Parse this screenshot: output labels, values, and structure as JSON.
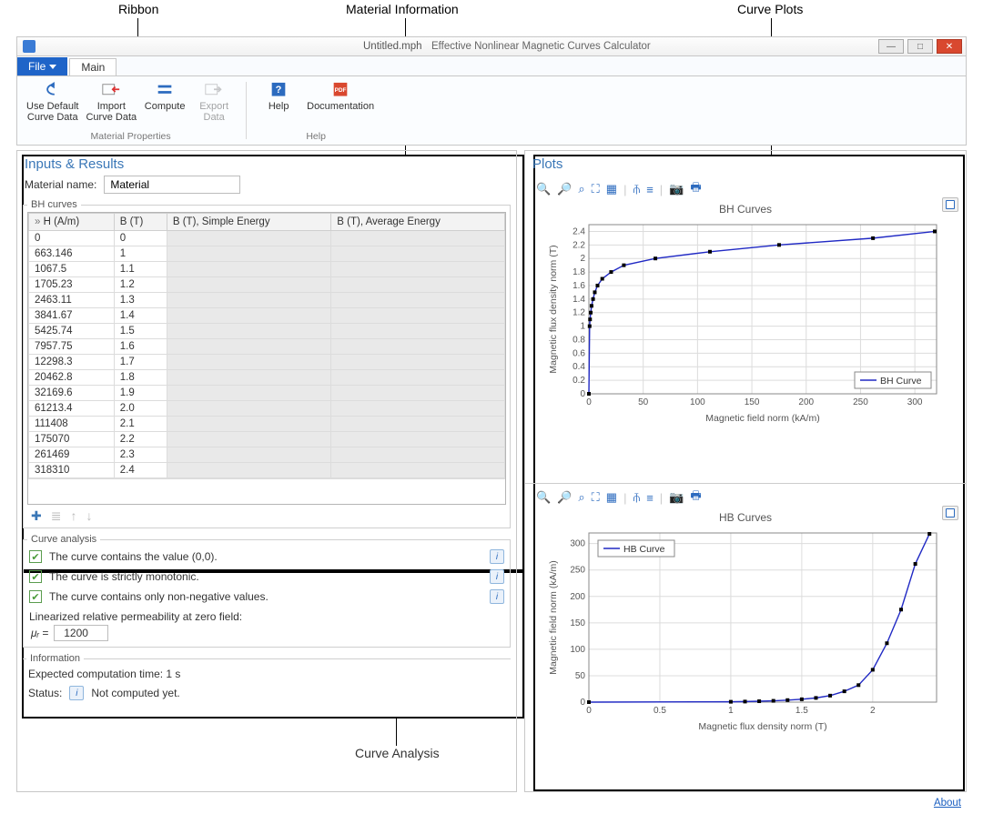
{
  "annotations": {
    "ribbon": "Ribbon",
    "material_info": "Material Information",
    "curve_plots": "Curve Plots",
    "curve_analysis": "Curve Analysis"
  },
  "window": {
    "file": "Untitled.mph",
    "app_title": "Effective Nonlinear Magnetic Curves Calculator",
    "min": "—",
    "max": "□",
    "close": "✕"
  },
  "tabs": {
    "file": "File",
    "main": "Main"
  },
  "ribbon": {
    "buttons": [
      {
        "label1": "Use Default",
        "label2": "Curve Data",
        "name": "use-default-button",
        "enabled": true
      },
      {
        "label1": "Import",
        "label2": "Curve Data",
        "name": "import-button",
        "enabled": true
      },
      {
        "label1": "Compute",
        "label2": "",
        "name": "compute-button",
        "enabled": true
      },
      {
        "label1": "Export",
        "label2": "Data",
        "name": "export-button",
        "enabled": false
      }
    ],
    "group1": "Material Properties",
    "help_buttons": [
      {
        "label": "Help",
        "name": "help-button"
      },
      {
        "label": "Documentation",
        "name": "documentation-button"
      }
    ],
    "group2": "Help"
  },
  "inputs": {
    "section_title": "Inputs & Results",
    "material_name_label": "Material name:",
    "material_name_value": "Material",
    "bh_group": "BH curves",
    "columns": [
      "H (A/m)",
      "B (T)",
      "B (T), Simple Energy",
      "B (T), Average Energy"
    ],
    "rows": [
      [
        "0",
        "0"
      ],
      [
        "663.146",
        "1"
      ],
      [
        "1067.5",
        "1.1"
      ],
      [
        "1705.23",
        "1.2"
      ],
      [
        "2463.11",
        "1.3"
      ],
      [
        "3841.67",
        "1.4"
      ],
      [
        "5425.74",
        "1.5"
      ],
      [
        "7957.75",
        "1.6"
      ],
      [
        "12298.3",
        "1.7"
      ],
      [
        "20462.8",
        "1.8"
      ],
      [
        "32169.6",
        "1.9"
      ],
      [
        "61213.4",
        "2.0"
      ],
      [
        "111408",
        "2.1"
      ],
      [
        "175070",
        "2.2"
      ],
      [
        "261469",
        "2.3"
      ],
      [
        "318310",
        "2.4"
      ]
    ]
  },
  "analysis": {
    "group": "Curve analysis",
    "checks": [
      "The curve contains the value (0,0).",
      "The curve is strictly monotonic.",
      "The curve contains only non-negative values."
    ],
    "perm_label": "Linearized relative permeability at zero field:",
    "mu_symbol": "μᵣ =",
    "mu_value": "1200"
  },
  "info": {
    "group": "Information",
    "time": "Expected computation time: 1 s",
    "status_label": "Status:",
    "status_value": "Not computed yet."
  },
  "plots": {
    "section_title": "Plots",
    "bh": {
      "title": "BH Curves",
      "xlabel": "Magnetic field norm (kA/m)",
      "ylabel": "Magnetic flux density norm (T)",
      "legend": "BH Curve"
    },
    "hb": {
      "title": "HB Curves",
      "xlabel": "Magnetic flux density norm (T)",
      "ylabel": "Magnetic field norm (kA/m)",
      "legend": "HB Curve"
    }
  },
  "footer": {
    "about": "About"
  },
  "chart_data": [
    {
      "type": "line",
      "title": "BH Curves",
      "xlabel": "Magnetic field norm (kA/m)",
      "ylabel": "Magnetic flux density norm (T)",
      "xlim": [
        0,
        320
      ],
      "ylim": [
        0,
        2.5
      ],
      "xticks": [
        0,
        50,
        100,
        150,
        200,
        250,
        300
      ],
      "yticks": [
        0,
        0.2,
        0.4,
        0.6,
        0.8,
        1,
        1.2,
        1.4,
        1.6,
        1.8,
        2,
        2.2,
        2.4
      ],
      "series": [
        {
          "name": "BH Curve",
          "x": [
            0,
            0.663,
            1.068,
            1.705,
            2.463,
            3.842,
            5.426,
            7.958,
            12.298,
            20.463,
            32.17,
            61.213,
            111.408,
            175.07,
            261.469,
            318.31
          ],
          "y": [
            0,
            1,
            1.1,
            1.2,
            1.3,
            1.4,
            1.5,
            1.6,
            1.7,
            1.8,
            1.9,
            2.0,
            2.1,
            2.2,
            2.3,
            2.4
          ]
        }
      ],
      "legend_position": "bottom-right"
    },
    {
      "type": "line",
      "title": "HB Curves",
      "xlabel": "Magnetic flux density norm (T)",
      "ylabel": "Magnetic field norm (kA/m)",
      "xlim": [
        0,
        2.45
      ],
      "ylim": [
        0,
        320
      ],
      "xticks": [
        0,
        0.5,
        1,
        1.5,
        2
      ],
      "yticks": [
        0,
        50,
        100,
        150,
        200,
        250,
        300
      ],
      "series": [
        {
          "name": "HB Curve",
          "x": [
            0,
            1,
            1.1,
            1.2,
            1.3,
            1.4,
            1.5,
            1.6,
            1.7,
            1.8,
            1.9,
            2.0,
            2.1,
            2.2,
            2.3,
            2.4
          ],
          "y": [
            0,
            0.663,
            1.068,
            1.705,
            2.463,
            3.842,
            5.426,
            7.958,
            12.298,
            20.463,
            32.17,
            61.213,
            111.408,
            175.07,
            261.469,
            318.31
          ]
        }
      ],
      "legend_position": "top-left"
    }
  ]
}
